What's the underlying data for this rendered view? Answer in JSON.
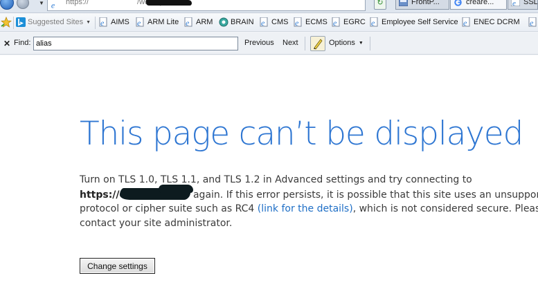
{
  "address_bar": {
    "url_prefix": "https://",
    "url_suffix": "/webtop"
  },
  "tabs": [
    {
      "label": "FrontP...",
      "icon": "frontpage-icon"
    },
    {
      "label": "creare...",
      "icon": "google-icon"
    },
    {
      "label": "SSL C",
      "icon": "ie-page-icon"
    }
  ],
  "favorites": {
    "suggested_label": "Suggested Sites",
    "items": [
      "AIMS",
      "ARM Lite",
      "ARM",
      "BRAIN",
      "CMS",
      "ECMS",
      "EGRC",
      "Employee Self Service",
      "ENEC DCRM"
    ]
  },
  "find_bar": {
    "label": "Find:",
    "value": "alias",
    "previous_label": "Previous",
    "next_label": "Next",
    "options_label": "Options"
  },
  "error_page": {
    "title": "This page can’t be displayed",
    "line1": "Turn on TLS 1.0, TLS 1.1, and TLS 1.2 in Advanced settings and try connecting to",
    "url_bold_prefix": "https://",
    "line2_rest": " again. If this error persists, it is possible that this site uses an unsupported",
    "line3_pre": "protocol or cipher suite such as RC4 ",
    "link_text": "(link for the details)",
    "line3_post": ", which is not considered secure. Please",
    "line4": "contact your site administrator.",
    "button_label": "Change settings"
  },
  "colors": {
    "title": "#2e76d2",
    "link": "#1f6fc6",
    "body_text": "#3a3a3a"
  }
}
